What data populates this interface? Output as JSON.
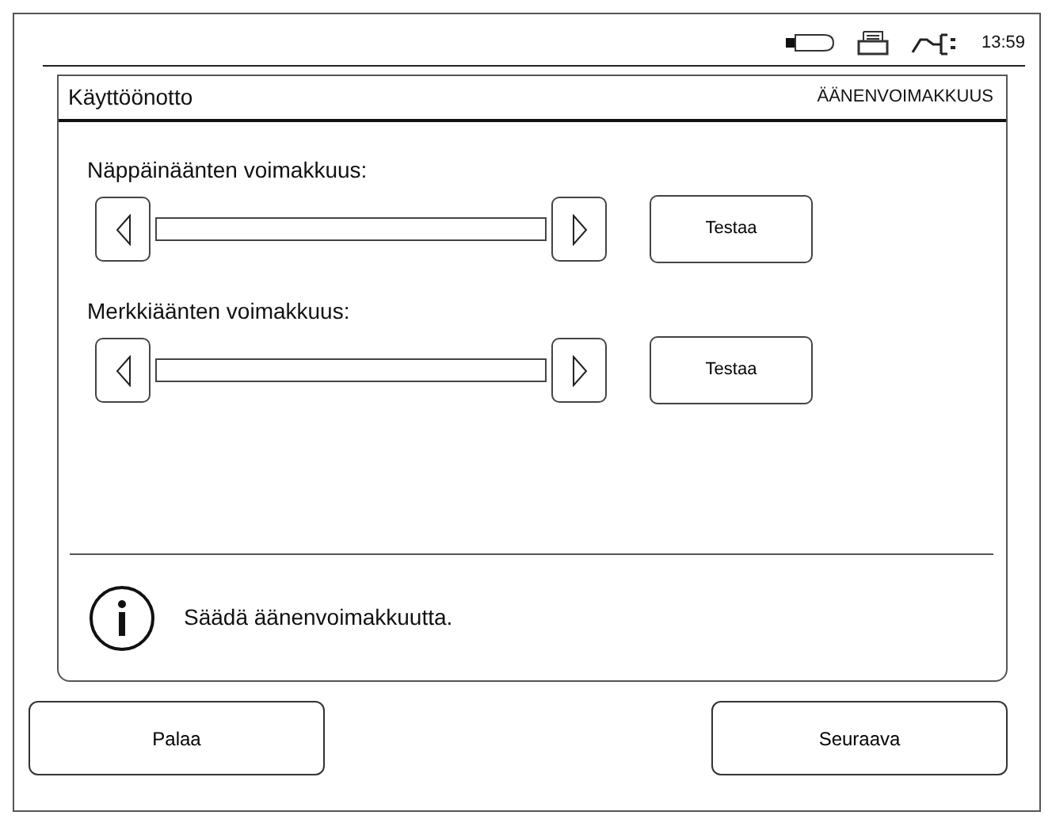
{
  "status_bar": {
    "time": "13:59"
  },
  "panel": {
    "title": "Käyttöönotto",
    "section": "ÄÄNENVOIMAKKUUS",
    "sliders": [
      {
        "label": "Näppäinäänten voimakkuus:",
        "level": 0,
        "button": "Testaa"
      },
      {
        "label": "Merkkiäänten voimakkuus:",
        "level": 0,
        "button": "Testaa"
      }
    ],
    "info": "Säädä äänenvoimakkuutta."
  },
  "buttons": [
    {
      "label": "Palaa"
    },
    {
      "label": "Seuraava"
    }
  ]
}
